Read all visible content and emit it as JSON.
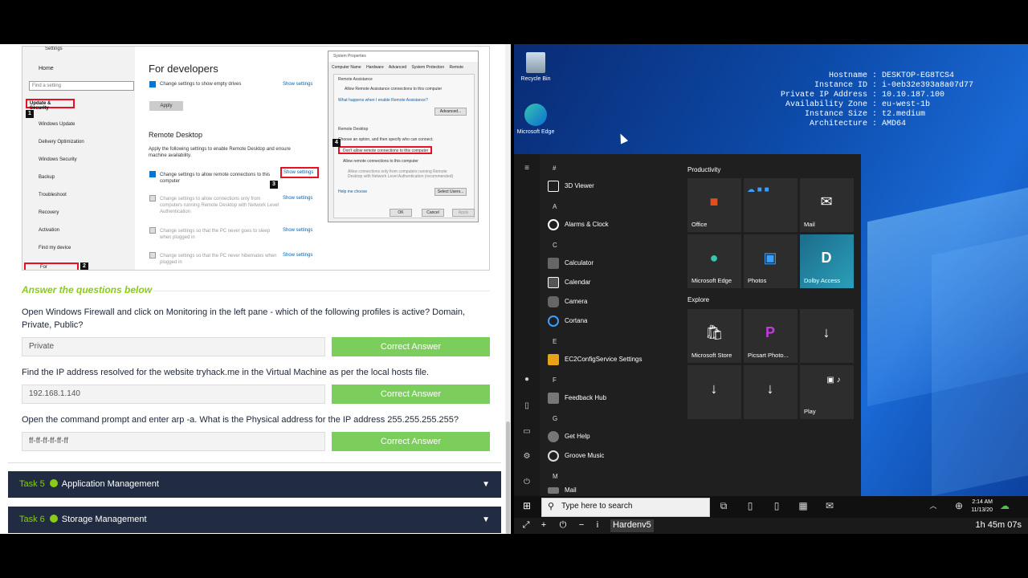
{
  "screenshot": {
    "settings_title": "Settings",
    "home": "Home",
    "find_setting": "Find a setting",
    "update_security": "Update & Security",
    "nav_items": [
      "Windows Update",
      "Delivery Optimization",
      "Windows Security",
      "Backup",
      "Troubleshoot",
      "Recovery",
      "Activation",
      "Find my device"
    ],
    "for_developers_nav": "For developers",
    "page_title": "For developers",
    "empty_drives": "Change settings to show empty drives",
    "show_settings": "Show settings",
    "apply": "Apply",
    "remote_desktop": "Remote Desktop",
    "rd_desc": "Apply the following settings to enable Remote Desktop and ensure machine availability.",
    "rd_allow": "Change settings to allow remote connections to this computer",
    "rd_nla": "Change settings to allow connections only from computers running Remote Desktop with Network Level Authentication",
    "rd_sleep": "Change settings so that the PC never goes to sleep when plugged in",
    "rd_hibernate": "Change settings so that the PC never hibernates when plugged in",
    "badges": [
      "1",
      "2",
      "3",
      "4"
    ],
    "sysprops": {
      "title": "System Properties",
      "tabs": [
        "Computer Name",
        "Hardware",
        "Advanced",
        "System Protection",
        "Remote"
      ],
      "ra_header": "Remote Assistance",
      "ra_allow": "Allow Remote Assistance connections to this computer",
      "ra_link": "What happens when I enable Remote Assistance?",
      "advanced": "Advanced...",
      "rd_header": "Remote Desktop",
      "choose": "Choose an option, and then specify who can connect.",
      "dont_allow": "Don't allow remote connections to this computer",
      "allow": "Allow remote connections to this computer",
      "nla": "Allow connections only from computers running Remote Desktop with Network Level Authentication (recommended)",
      "help": "Help me choose",
      "select_users": "Select Users...",
      "ok": "OK",
      "cancel": "Cancel",
      "apply": "Apply"
    }
  },
  "answer_header": "Answer the questions below",
  "questions": [
    {
      "q": "Open Windows Firewall and click on Monitoring in the left pane - which of the following profiles is active? Domain, Private, Public?",
      "a": "Private",
      "btn": "Correct Answer"
    },
    {
      "q": "Find the IP address resolved for the website tryhack.me in the Virtual Machine as per the local hosts file.",
      "a": "192.168.1.140",
      "btn": "Correct Answer"
    },
    {
      "q": "Open the command prompt and enter arp -a. What is the Physical address for the IP address 255.255.255.255?",
      "a": "ff-ff-ff-ff-ff-ff",
      "btn": "Correct Answer"
    }
  ],
  "tasks": [
    {
      "num": "Task 5",
      "title": "Application Management"
    },
    {
      "num": "Task 6",
      "title": "Storage Management"
    }
  ],
  "desktop": {
    "recycle_bin": "Recycle Bin",
    "edge": "Microsoft Edge",
    "info_rows": [
      {
        "k": "Hostname",
        "v": "DESKTOP-EG8TCS4"
      },
      {
        "k": "Instance ID",
        "v": "i-0eb32e393a8a07d77"
      },
      {
        "k": "Private IP Address",
        "v": "10.10.187.100"
      },
      {
        "k": "Availability Zone",
        "v": "eu-west-1b"
      },
      {
        "k": "Instance Size",
        "v": "t2.medium"
      },
      {
        "k": "Architecture",
        "v": "AMD64"
      }
    ]
  },
  "start": {
    "letters": {
      "hash": "#",
      "a": "A",
      "c": "C",
      "e": "E",
      "f": "F",
      "g": "G",
      "m": "M"
    },
    "apps": {
      "viewer3d": "3D Viewer",
      "alarms": "Alarms & Clock",
      "calculator": "Calculator",
      "calendar": "Calendar",
      "camera": "Camera",
      "cortana": "Cortana",
      "ec2": "EC2ConfigService Settings",
      "feedback": "Feedback Hub",
      "gethelp": "Get Help",
      "groove": "Groove Music",
      "mail": "Mail"
    },
    "groups": {
      "productivity": "Productivity",
      "explore": "Explore"
    },
    "tiles": {
      "office": "Office",
      "mail": "Mail",
      "edge": "Microsoft Edge",
      "photos": "Photos",
      "dolby": "Dolby Access",
      "store": "Microsoft Store",
      "picsart": "Picsart Photo...",
      "play": "Play"
    }
  },
  "taskbar": {
    "search_placeholder": "Type here to search",
    "time": "2:14 AM",
    "date": "11/13/20"
  },
  "bottom": {
    "machine": "Hardenv5",
    "timer": "1h 45m 07s"
  }
}
